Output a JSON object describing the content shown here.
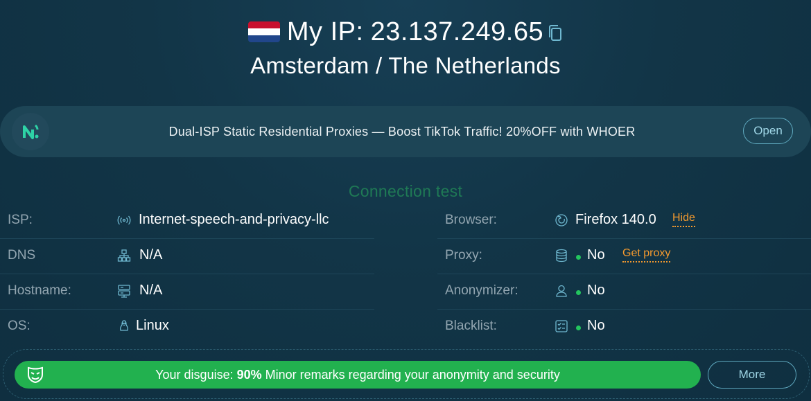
{
  "header": {
    "flag_country": "Netherlands",
    "flag_colors": [
      "#c8102e",
      "#ffffff",
      "#21468b"
    ],
    "ip_label": "My IP:",
    "ip_value": "23.137.249.65",
    "location": "Amsterdam / The Netherlands"
  },
  "banner": {
    "text": "Dual-ISP Static Residential Proxies — Boost TikTok Traffic! 20%OFF with WHOER",
    "open_label": "Open"
  },
  "connection": {
    "title": "Connection test",
    "left": [
      {
        "label": "ISP:",
        "value": "Internet-speech-and-privacy-llc",
        "icon": "signal-icon"
      },
      {
        "label": "DNS",
        "value": "N/A",
        "icon": "network-icon"
      },
      {
        "label": "Hostname:",
        "value": "N/A",
        "icon": "server-icon"
      },
      {
        "label": "OS:",
        "value": "Linux",
        "icon": "linux-icon"
      }
    ],
    "right": [
      {
        "label": "Browser:",
        "value": "Firefox 140.0",
        "icon": "firefox-icon",
        "action": "Hide"
      },
      {
        "label": "Proxy:",
        "value": "No",
        "icon": "database-icon",
        "action": "Get proxy"
      },
      {
        "label": "Anonymizer:",
        "value": "No",
        "icon": "user-icon"
      },
      {
        "label": "Blacklist:",
        "value": "No",
        "icon": "checklist-icon"
      }
    ]
  },
  "disguise": {
    "label": "Your disguise:",
    "percent": "90%",
    "message": "Minor remarks regarding your anonymity and security",
    "more_label": "More"
  },
  "colors": {
    "accent_green": "#22b14f",
    "status_dot": "#23c55e",
    "link_orange": "#f59a2e",
    "outline_blue": "#5fa9bf"
  }
}
